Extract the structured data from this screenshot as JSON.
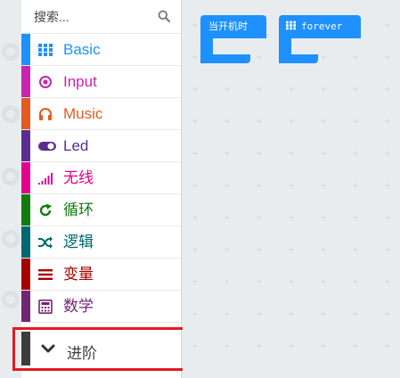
{
  "search": {
    "placeholder": "搜索..."
  },
  "categories": [
    {
      "label": "Basic",
      "color": "#1e90ff",
      "icon": "grid-icon"
    },
    {
      "label": "Input",
      "color": "#c724b1",
      "icon": "radio-target-icon"
    },
    {
      "label": "Music",
      "color": "#e35b20",
      "icon": "headphones-icon"
    },
    {
      "label": "Led",
      "color": "#5c2d91",
      "icon": "toggle-icon"
    },
    {
      "label": "无线",
      "color": "#e3008c",
      "icon": "signal-bars-icon"
    },
    {
      "label": "循环",
      "color": "#107c10",
      "icon": "refresh-icon"
    },
    {
      "label": "逻辑",
      "color": "#006970",
      "icon": "shuffle-icon"
    },
    {
      "label": "变量",
      "color": "#a80000",
      "icon": "lines-icon"
    },
    {
      "label": "数学",
      "color": "#712672",
      "icon": "calculator-icon"
    }
  ],
  "advanced": {
    "label": "进阶",
    "icon": "chevron-down-icon"
  },
  "blocks": [
    {
      "label": "当开机时"
    },
    {
      "label": "forever",
      "icon": "grid-icon"
    }
  ],
  "colors": {
    "block": "#1e90ff",
    "highlight": "#e01b22",
    "workspace": "#e9ecee"
  }
}
